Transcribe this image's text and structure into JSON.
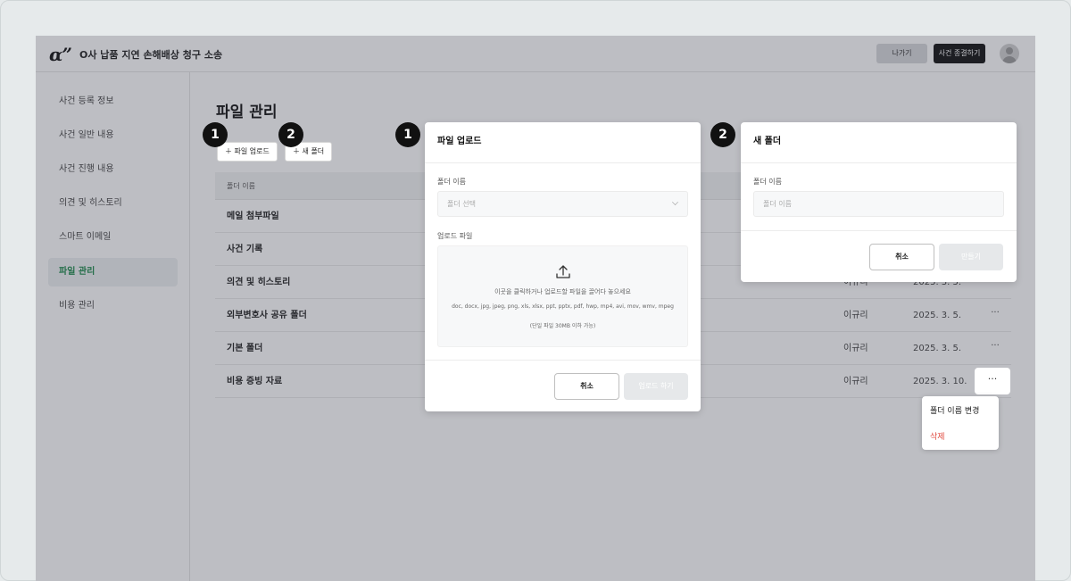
{
  "header": {
    "logo": "α”",
    "case_title": "O사 납품 지연 손해배상 청구 소송",
    "exit_label": "나가기",
    "close_case_label": "사건 종결하기"
  },
  "sidebar": {
    "items": [
      {
        "label": "사건 등록 정보"
      },
      {
        "label": "사건 일반 내용"
      },
      {
        "label": "사건 진행 내용"
      },
      {
        "label": "의견 및 히스토리"
      },
      {
        "label": "스마트 이메일"
      },
      {
        "label": "파일 관리"
      },
      {
        "label": "비용 관리"
      }
    ],
    "active_index": 5
  },
  "main": {
    "title": "파일 관리",
    "upload_btn": "파일 업로드",
    "new_folder_btn": "새 폴더",
    "table_header": "폴더 이름",
    "rows": [
      {
        "name": "메일 첨부파일",
        "owner": "",
        "date": ""
      },
      {
        "name": "사건 기록",
        "owner": "",
        "date": ""
      },
      {
        "name": "의견 및 히스토리",
        "owner": "이규리",
        "date": "2025. 3. 5."
      },
      {
        "name": "외부변호사 공유 폴더",
        "owner": "이규리",
        "date": "2025. 3. 5."
      },
      {
        "name": "기본 폴더",
        "owner": "이규리",
        "date": "2025. 3. 5."
      },
      {
        "name": "비용 증빙 자료",
        "owner": "이규리",
        "date": "2025. 3. 10."
      }
    ],
    "more_label": "···"
  },
  "badges": {
    "one": "1",
    "two": "2"
  },
  "upload_modal": {
    "title": "파일 업로드",
    "folder_label": "폴더 이름",
    "folder_placeholder": "폴더 선택",
    "file_label": "업로드 파일",
    "drop_text": "이곳을 클릭하거나 업로드할 파일을 끌어다 놓으세요",
    "formats": "doc, docx, jpg, jpeg, png, xls, xlsx, ppt, pptx, pdf, hwp, mp4, avi, mov, wmv, mpeg",
    "limit": "(단일 파일 30MB 이하 가능)",
    "cancel": "취소",
    "submit": "업로드 하기"
  },
  "folder_modal": {
    "title": "새 폴더",
    "name_label": "폴더 이름",
    "name_placeholder": "폴더 이름",
    "cancel": "취소",
    "submit": "만들기"
  },
  "context_menu": {
    "rename": "폴더 이름 변경",
    "delete": "삭제"
  },
  "colors": {
    "accent_green": "#1f8a4c",
    "danger": "#e04a3f",
    "overlay": "#373a48"
  }
}
